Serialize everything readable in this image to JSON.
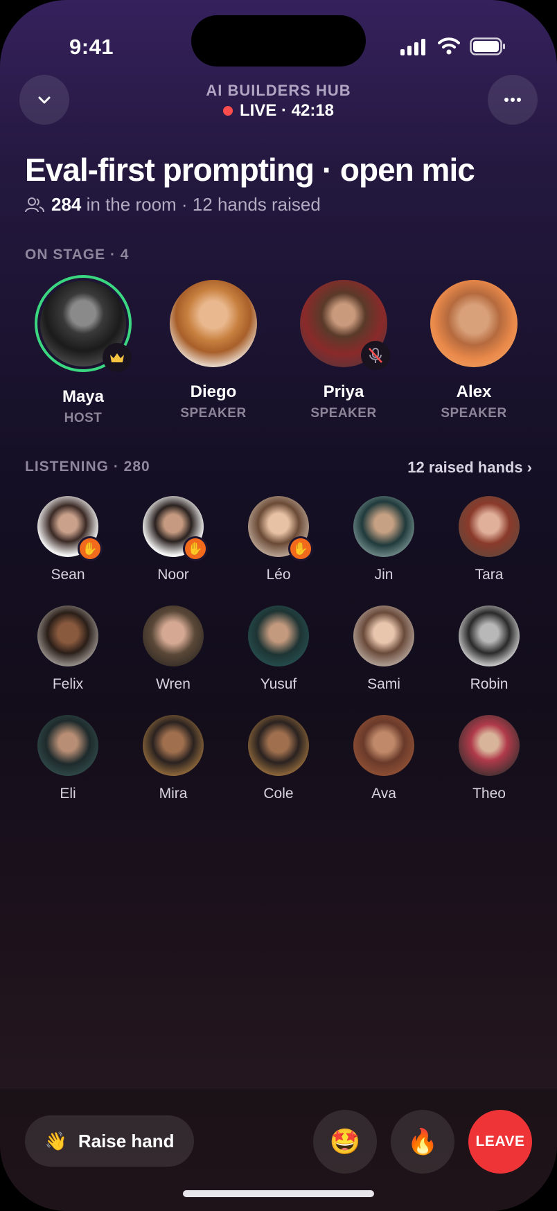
{
  "status_bar": {
    "time": "9:41"
  },
  "header": {
    "community": "AI BUILDERS HUB",
    "live_text": "LIVE · 42:18",
    "collapse_icon": "chevron-down-icon",
    "more_icon": "more-horizontal-icon"
  },
  "room": {
    "title": "Eval-first prompting · open mic",
    "count": "284",
    "count_suffix": "in the room · 12 hands raised"
  },
  "stage": {
    "label": "ON STAGE · 4",
    "speakers": [
      {
        "name": "Maya",
        "role": "HOST",
        "badge": "crown-icon"
      },
      {
        "name": "Diego",
        "role": "SPEAKER"
      },
      {
        "name": "Priya",
        "role": "SPEAKER",
        "badge": "mic-off-icon"
      },
      {
        "name": "Alex",
        "role": "SPEAKER"
      }
    ]
  },
  "listening": {
    "label": "LISTENING · 280",
    "raised_link": "12 raised hands ›",
    "people": [
      {
        "name": "Sean",
        "hand_raised": true
      },
      {
        "name": "Noor",
        "hand_raised": true
      },
      {
        "name": "Léo",
        "hand_raised": true
      },
      {
        "name": "Jin",
        "hand_raised": false
      },
      {
        "name": "Tara",
        "hand_raised": false
      },
      {
        "name": "Felix",
        "hand_raised": false
      },
      {
        "name": "Wren",
        "hand_raised": false
      },
      {
        "name": "Yusuf",
        "hand_raised": false
      },
      {
        "name": "Sami",
        "hand_raised": false
      },
      {
        "name": "Robin",
        "hand_raised": false
      },
      {
        "name": "Eli",
        "hand_raised": false
      },
      {
        "name": "Mira",
        "hand_raised": false
      },
      {
        "name": "Cole",
        "hand_raised": false
      },
      {
        "name": "Ava",
        "hand_raised": false
      },
      {
        "name": "Theo",
        "hand_raised": false
      }
    ]
  },
  "actions": {
    "raise_hand": "Raise hand",
    "raise_emoji": "👋",
    "reaction_1": "🤩",
    "reaction_2": "🔥",
    "leave": "LEAVE"
  },
  "colors": {
    "live_dot": "#ff4d4d",
    "host_ring": "#3ad680",
    "hand_badge": "#f26b1d",
    "leave": "#ee3437"
  }
}
